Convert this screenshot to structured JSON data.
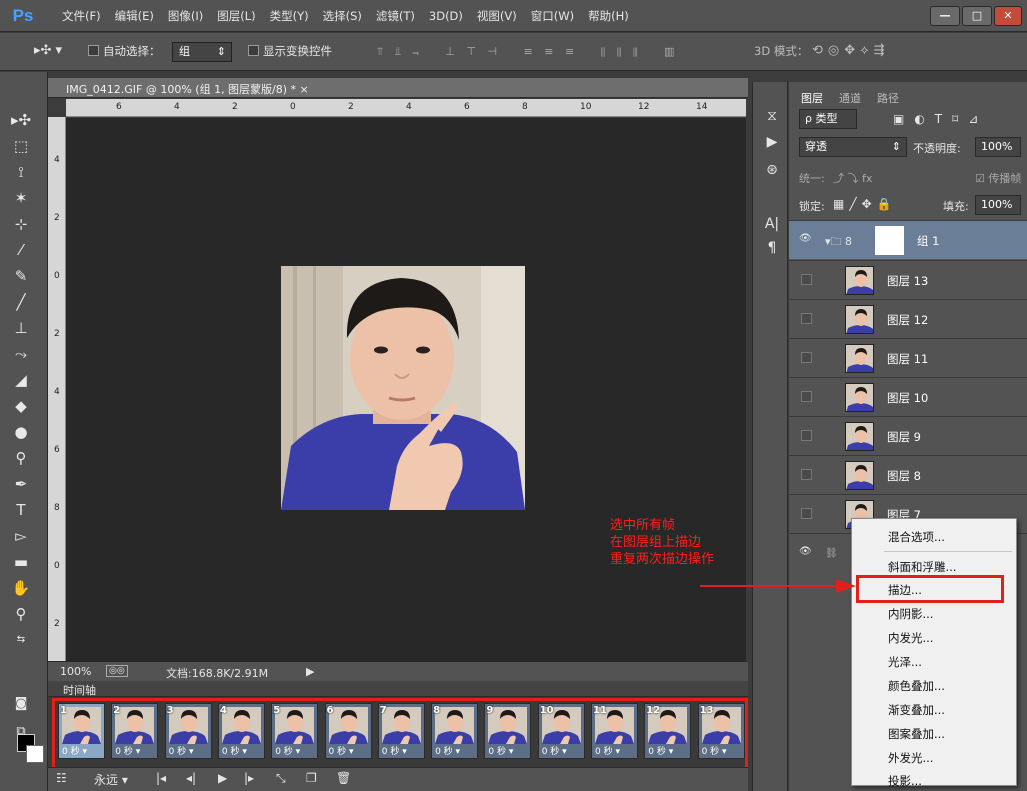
{
  "app": {
    "logo": "Ps"
  },
  "menu": [
    "文件(F)",
    "编辑(E)",
    "图像(I)",
    "图层(L)",
    "类型(Y)",
    "选择(S)",
    "滤镜(T)",
    "3D(D)",
    "视图(V)",
    "窗口(W)",
    "帮助(H)"
  ],
  "window_buttons": [
    "—",
    "□",
    "✕"
  ],
  "options": {
    "auto_select_label": "自动选择：",
    "auto_select_value": "组",
    "show_transform_label": "显示变换控件",
    "mode_3d_label": "3D 模式："
  },
  "document": {
    "tab_title": "IMG_0412.GIF @ 100% (组 1, 图层蒙版/8) * ×",
    "ruler_top_labels": [
      "6",
      "4",
      "2",
      "0",
      "2",
      "4",
      "6",
      "8",
      "10",
      "12",
      "14"
    ],
    "ruler_left_labels": [
      "4",
      "2",
      "0",
      "2",
      "4",
      "6",
      "8",
      "0",
      "2"
    ]
  },
  "status": {
    "zoom": "100%",
    "doc_info": "文档:168.8K/2.91M"
  },
  "annotation": {
    "lines": [
      "选中所有帧",
      "在图层组上描边",
      "重复两次描边操作"
    ]
  },
  "timeline": {
    "title": "时间轴",
    "frames": [
      {
        "num": "1",
        "duration": "0 秒"
      },
      {
        "num": "2",
        "duration": "0 秒"
      },
      {
        "num": "3",
        "duration": "0 秒"
      },
      {
        "num": "4",
        "duration": "0 秒"
      },
      {
        "num": "5",
        "duration": "0 秒"
      },
      {
        "num": "6",
        "duration": "0 秒"
      },
      {
        "num": "7",
        "duration": "0 秒"
      },
      {
        "num": "8",
        "duration": "0 秒"
      },
      {
        "num": "9",
        "duration": "0 秒"
      },
      {
        "num": "10",
        "duration": "0 秒"
      },
      {
        "num": "11",
        "duration": "0 秒"
      },
      {
        "num": "12",
        "duration": "0 秒"
      },
      {
        "num": "13",
        "duration": "0 秒"
      }
    ],
    "loop_label": "永远"
  },
  "layers_panel": {
    "tabs": [
      "图层",
      "通道",
      "路径"
    ],
    "filter_kind": "ρ 类型",
    "blend_mode": "穿透",
    "opacity_label": "不透明度:",
    "opacity_value": "100%",
    "unify_label": "统一:",
    "propagate_label": "传播帧",
    "lock_label": "锁定:",
    "fill_label": "填充:",
    "fill_value": "100%",
    "group_name": "组 1",
    "layers": [
      "图层 13",
      "图层 12",
      "图层 11",
      "图层 10",
      "图层 9",
      "图层 8",
      "图层 7"
    ]
  },
  "context_menu": {
    "items": [
      "混合选项...",
      "斜面和浮雕...",
      "描边...",
      "内阴影...",
      "内发光...",
      "光泽...",
      "颜色叠加...",
      "渐变叠加...",
      "图案叠加...",
      "外发光...",
      "投影..."
    ]
  },
  "colors": {
    "highlight": "#e0201d",
    "annotation": "#ff1e1e",
    "ps_blue": "#46a2ff",
    "shirt": "#3b3ea8"
  }
}
